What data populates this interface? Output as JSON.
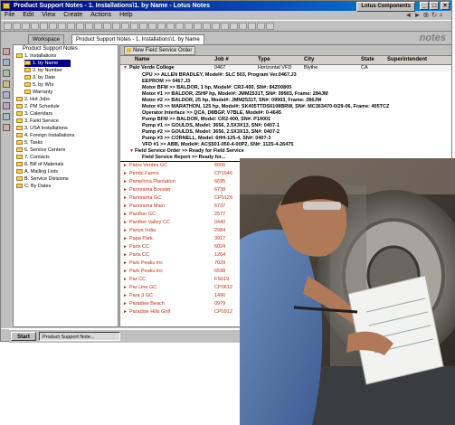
{
  "window": {
    "title": "Product Support Notes - 1. Installations\\1. by Name - Lotus Notes",
    "brand": "Lotus Components",
    "controls": [
      "_",
      "□",
      "×"
    ]
  },
  "menu": [
    "File",
    "Edit",
    "View",
    "Create",
    "Actions",
    "Help"
  ],
  "tabs": [
    {
      "label": "Workspace",
      "active": false
    },
    {
      "label": "Product Support Notes - 1. Installations\\1. by Name",
      "active": true
    }
  ],
  "logo": "notes",
  "navigator": {
    "header": "Product Support Notes",
    "items": [
      {
        "label": "1. Installations",
        "level": 1
      },
      {
        "label": "1. by Name",
        "level": 2,
        "selected": true
      },
      {
        "label": "2. by Number",
        "level": 2
      },
      {
        "label": "3. by Date",
        "level": 2
      },
      {
        "label": "5. by Whr",
        "level": 2
      },
      {
        "label": "Warranty",
        "level": 2
      },
      {
        "label": "2. Hot Jobs",
        "level": 1
      },
      {
        "label": "2. PM Schedule",
        "level": 1
      },
      {
        "label": "3. Calendars",
        "level": 1
      },
      {
        "label": "3. Field Service",
        "level": 1
      },
      {
        "label": "3. USA Installations",
        "level": 1
      },
      {
        "label": "4. Foreign Installations",
        "level": 1
      },
      {
        "label": "5. Tasks",
        "level": 1
      },
      {
        "label": "6. Service Centers",
        "level": 1
      },
      {
        "label": "7. Contacts",
        "level": 1
      },
      {
        "label": "8. Bill of Materials",
        "level": 1
      },
      {
        "label": "A. Mailing Lists",
        "level": 1
      },
      {
        "label": "B. Service Divisions",
        "level": 1
      },
      {
        "label": "C. By Dates",
        "level": 1
      }
    ]
  },
  "action_button": "New Field Service Order",
  "columns": [
    "Name",
    "Job #",
    "Type",
    "City",
    "State",
    "Superintendent"
  ],
  "expanded_row": {
    "name": "Palo Verde College",
    "job": "0467",
    "type": "Horizontal VFD",
    "city": "Blythe",
    "state": "CA"
  },
  "detail_lines": [
    "CPU >> ALLEN BRADLEY, Model#: SLC 503, Program Ver.0467.J3",
    "EEPROM >> 0467.J3",
    "Motor BFM >> BALDOR, 1 hp, Model#: CR3-400, SN#: 84Z00805",
    "Motor #1 >> BALDOR, 25HP hp, Model#: JMM2531T, SN#: 09903, Frame: 284JM",
    "Motor #2 >> BALDOR, 25 hp, Model#: JMM2531T, SN#: 09903, Frame: 286JM",
    "Motor #3 >> MARATHON, 125 hp, Model#: SK405TTDS6108BRW, SN#: MC363470-0/29-06, Frame: 405TCZ",
    "Operator Interface >> QCA, D8BGP, V7BLE, Model#: 0-4645",
    "Pump BFM >> BALDOR, Model: CR2-400, SN#: P19001",
    "Pump #1 >> GOULDS, Model: 3656, 2.5X3X13, SN#: 0407-1",
    "Pump #2 >> GOULDS, Model: 3656, 2.5X3X13, SN#: 0407-2",
    "Pump #3 >> CORNELL, Model: 6HH-125-4, SN#: 0407-3",
    "VFD #1 >> ABB, Model#: ACS501-050-4-00P2, SN#: 1125-4-26475",
    "Field Service Order >> Ready for Field Service",
    "Field Service Report >> Ready for..."
  ],
  "rows": [
    {
      "name": "Palos Verdes GC",
      "job": "6666"
    },
    {
      "name": "Pembi Farms",
      "job": "CP1646"
    },
    {
      "name": "Pamplona Plantation",
      "job": "6695"
    },
    {
      "name": "Panorama Booster",
      "job": "6738"
    },
    {
      "name": "Panorama GC",
      "job": "CP0126"
    },
    {
      "name": "Panorama Main",
      "job": "6737"
    },
    {
      "name": "Panther GC",
      "job": "2577"
    },
    {
      "name": "Panther Valley CC",
      "job": "0440"
    },
    {
      "name": "Panya India",
      "job": "2984"
    },
    {
      "name": "Papa Park",
      "job": "3917"
    },
    {
      "name": "Paris CC",
      "job": "6024"
    },
    {
      "name": "Paris CC",
      "job": "1264"
    },
    {
      "name": "Park Peaks Inc",
      "job": "7029"
    },
    {
      "name": "Park Peaks Inc",
      "job": "6598"
    },
    {
      "name": "Par CC",
      "job": "FS019"
    },
    {
      "name": "Par Line GC",
      "job": "CP0612"
    },
    {
      "name": "Para 3 GC",
      "job": "1496"
    },
    {
      "name": "Paradise Beach",
      "job": "0979"
    },
    {
      "name": "Paradise Hills Golf",
      "job": "CP0912"
    }
  ],
  "taskbar": {
    "start": "Start",
    "app": "Product Support Note..."
  },
  "colors": {
    "titlebar": "#000080",
    "row_text": "#c03010",
    "selection": "#000080"
  }
}
